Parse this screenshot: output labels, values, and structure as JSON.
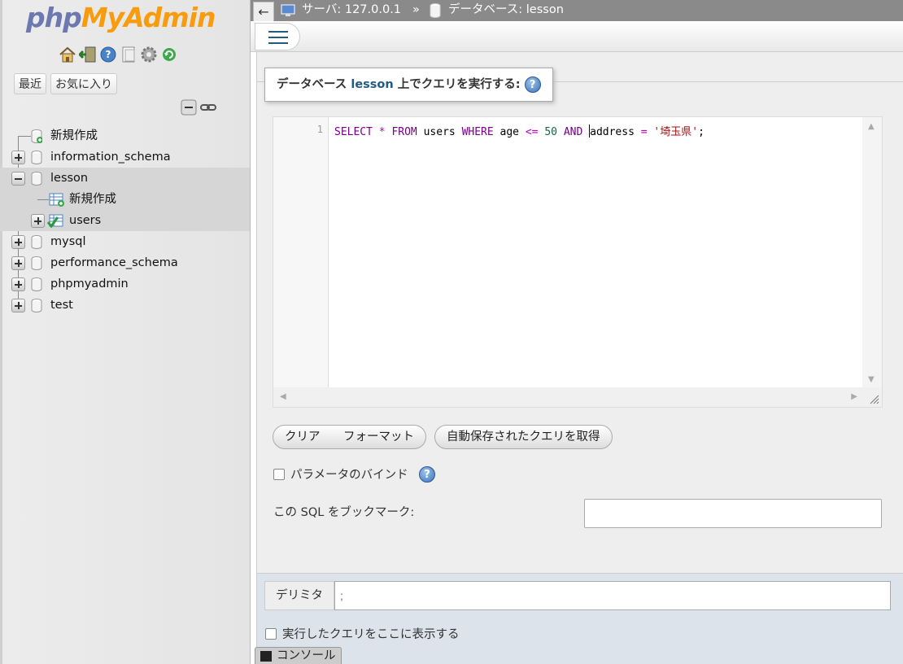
{
  "sidebar": {
    "logo": {
      "php": "php",
      "my": "My",
      "admin": "Admin"
    },
    "tabs": {
      "recent": "最近",
      "favorites": "お気に入り"
    },
    "tree": [
      {
        "label": "新規作成",
        "type": "new"
      },
      {
        "label": "information_schema",
        "type": "db"
      },
      {
        "label": "lesson",
        "type": "db",
        "expanded": true,
        "selected": true
      },
      {
        "label": "新規作成",
        "type": "new-table"
      },
      {
        "label": "users",
        "type": "table"
      },
      {
        "label": "mysql",
        "type": "db"
      },
      {
        "label": "performance_schema",
        "type": "db"
      },
      {
        "label": "phpmyadmin",
        "type": "db"
      },
      {
        "label": "test",
        "type": "db"
      }
    ]
  },
  "header": {
    "back": "←",
    "server_label": "サーバ: 127.0.0.1",
    "separator": "»",
    "database_label": "データベース: lesson"
  },
  "query": {
    "legend_prefix": "データベース",
    "legend_db": "lesson",
    "legend_suffix": "上でクエリを実行する:",
    "help": "?",
    "line_number": "1",
    "sql": "SELECT * FROM users WHERE age <= 50 AND address = '埼玉県';",
    "buttons": {
      "clear": "クリア",
      "format": "フォーマット",
      "autosaved": "自動保存されたクエリを取得"
    },
    "bind_params_label": "パラメータのバインド",
    "bookmark_label": "この SQL をブックマーク:",
    "bookmark_value": ""
  },
  "lower": {
    "delimiter_label": "デリミタ",
    "delimiter_value": ";",
    "show_query_label": "実行したクエリをここに表示する"
  },
  "console": {
    "label": "コンソール"
  },
  "colors": {
    "accent": "#235a81",
    "logo_blue": "#6c78af",
    "logo_orange": "#f89c0e",
    "topbar": "#8a8a8a"
  },
  "icons": [
    "home-icon",
    "exit-icon",
    "help-icon",
    "docs-icon",
    "settings-icon",
    "reload-icon",
    "collapse-icon",
    "link-icon",
    "database-icon",
    "table-icon",
    "console-icon"
  ]
}
